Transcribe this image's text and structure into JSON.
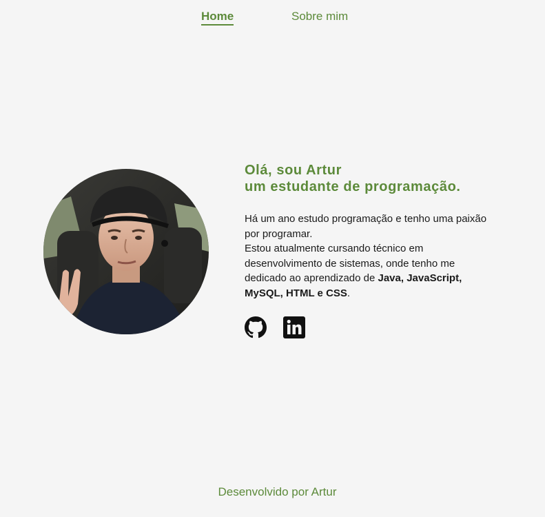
{
  "nav": {
    "home_label": "Home",
    "about_label": "Sobre mim"
  },
  "profile": {
    "avatar_alt": "Foto de Artur"
  },
  "intro": {
    "greeting_line1": "Olá, sou Artur",
    "greeting_line2": "um estudante de programação.",
    "bio_p1": "Há um ano estudo programação e tenho uma paixão por programar.",
    "bio_p2_start": "Estou atualmente cursando técnico em desenvolvimento de sistemas, onde tenho me dedicado ao aprendizado de ",
    "bio_p2_strong": "Java, JavaScript, MySQL, HTML e CSS",
    "bio_p2_end": "."
  },
  "social": {
    "github_icon": "github-icon",
    "linkedin_icon": "linkedin-icon"
  },
  "footer": {
    "text": "Desenvolvido por Artur"
  },
  "colors": {
    "accent": "#5c8a3a",
    "background": "#f5f5f5",
    "text": "#1a1a1a"
  }
}
